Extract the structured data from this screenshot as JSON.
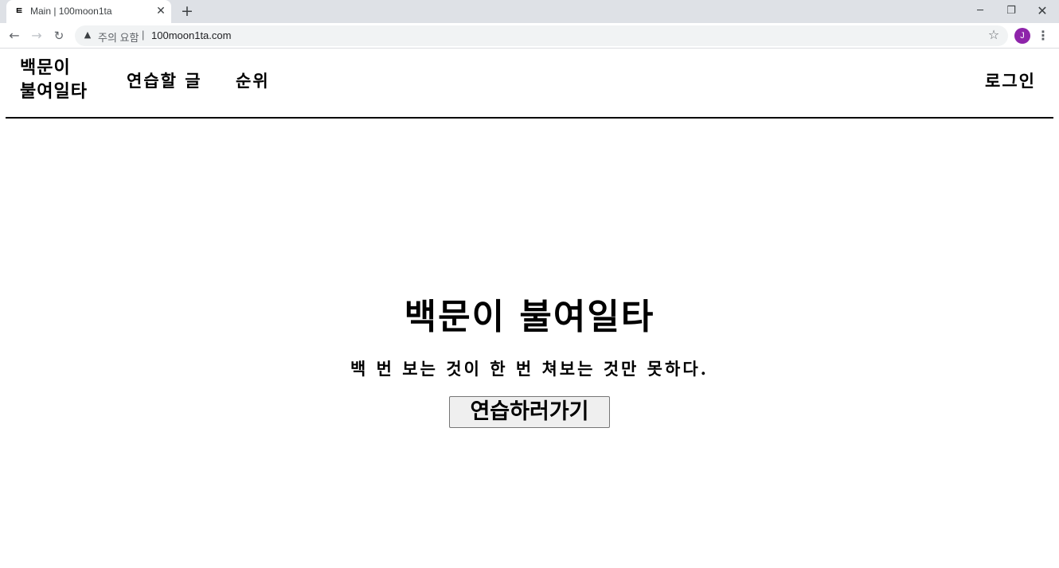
{
  "browser": {
    "tab": {
      "favicon_icon": "ㅌ",
      "title": "Main | 100moon1ta",
      "close_label": "✕"
    },
    "new_tab_label": "+",
    "window_controls": {
      "minimize": "─",
      "maximize": "❐",
      "close": "✕"
    },
    "nav": {
      "back": "←",
      "forward": "→",
      "reload": "↻"
    },
    "omnibox": {
      "warning_icon": "▲",
      "security_label": "주의 요함",
      "separator": "|",
      "url": "100moon1ta.com"
    },
    "bookmark_icon": "☆",
    "profile_initial": "J",
    "menu_icon": "⋮",
    "colors": {
      "tabstrip": "#dee1e6",
      "avatar": "#8e24aa"
    }
  },
  "site": {
    "logo": "백문이 불여일타",
    "nav": {
      "practice": "연습할 글",
      "ranking": "순위",
      "login": "로그인"
    },
    "hero": {
      "title": "백문이 불여일타",
      "subtitle": "백 번 보는 것이 한 번 쳐보는 것만 못하다.",
      "cta": "연습하러가기"
    }
  }
}
